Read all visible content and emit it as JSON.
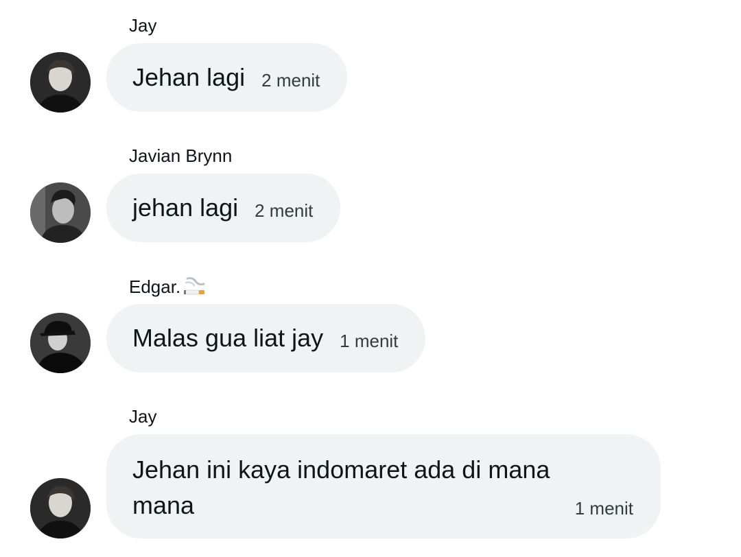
{
  "messages": [
    {
      "sender": "Jay",
      "text": "Jehan lagi",
      "time": "2 menit",
      "avatar": "avatar-jay"
    },
    {
      "sender": "Javian Brynn",
      "text": "jehan lagi",
      "time": "2 menit",
      "avatar": "avatar-javian"
    },
    {
      "sender": "Edgar.",
      "sender_emoji": "cigarette-emoji",
      "text": "Malas gua liat jay",
      "time": "1 menit",
      "avatar": "avatar-edgar"
    },
    {
      "sender": "Jay",
      "text": "Jehan ini kaya indomaret ada di mana mana",
      "time": "1 menit",
      "avatar": "avatar-jay"
    }
  ],
  "colors": {
    "bubble": "#eff3f4",
    "text": "#0f1419",
    "time": "#333a40",
    "background": "#ffffff"
  }
}
